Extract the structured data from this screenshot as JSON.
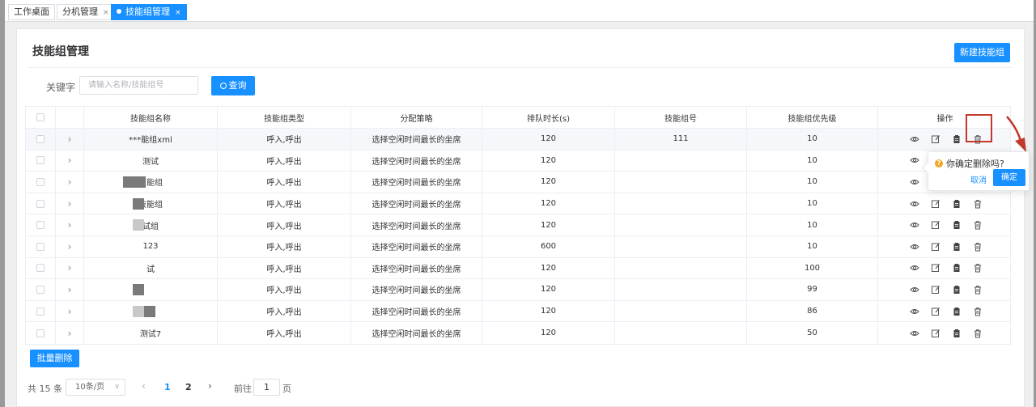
{
  "tabs": [
    {
      "label": "工作桌面",
      "closable": false,
      "active": false
    },
    {
      "label": "分机管理",
      "closable": true,
      "active": false
    },
    {
      "label": "技能组管理",
      "closable": true,
      "active": true
    }
  ],
  "tab_close_glyph": "×",
  "page": {
    "title": "技能组管理",
    "new_button": "新建技能组"
  },
  "search": {
    "label": "关键字",
    "placeholder": "请输入名称/技能组号",
    "value": "",
    "button": "查询"
  },
  "table": {
    "headers": [
      "技能组名称",
      "技能组类型",
      "分配策略",
      "排队时长(s)",
      "技能组号",
      "技能组优先级",
      "操作"
    ],
    "expand_glyph": "›",
    "rows": [
      {
        "name": "***能组xml",
        "type": "呼入,呼出",
        "strategy": "选择空闲时间最长的坐席",
        "queue": "120",
        "code": "111",
        "priority": "10"
      },
      {
        "name": "测试",
        "type": "呼入,呼出",
        "strategy": "选择空闲时间最长的坐席",
        "queue": "120",
        "code": "",
        "priority": "10"
      },
      {
        "name": "技能组",
        "type": "呼入,呼出",
        "strategy": "选择空闲时间最长的坐席",
        "queue": "120",
        "code": "",
        "priority": "10"
      },
      {
        "name": "技能组",
        "type": "呼入,呼出",
        "strategy": "选择空闲时间最长的坐席",
        "queue": "120",
        "code": "",
        "priority": "10"
      },
      {
        "name": "试组",
        "type": "呼入,呼出",
        "strategy": "选择空闲时间最长的坐席",
        "queue": "120",
        "code": "",
        "priority": "10"
      },
      {
        "name": "123",
        "type": "呼入,呼出",
        "strategy": "选择空闲时间最长的坐席",
        "queue": "600",
        "code": "",
        "priority": "10"
      },
      {
        "name": "试",
        "type": "呼入,呼出",
        "strategy": "选择空闲时间最长的坐席",
        "queue": "120",
        "code": "",
        "priority": "100"
      },
      {
        "name": "",
        "type": "呼入,呼出",
        "strategy": "选择空闲时间最长的坐席",
        "queue": "120",
        "code": "",
        "priority": "99"
      },
      {
        "name": "",
        "type": "呼入,呼出",
        "strategy": "选择空闲时间最长的坐席",
        "queue": "120",
        "code": "",
        "priority": "86"
      },
      {
        "name": "测试7",
        "type": "呼入,呼出",
        "strategy": "选择空闲时间最长的坐席",
        "queue": "120",
        "code": "",
        "priority": "50"
      }
    ],
    "row_actions": [
      "eye-icon",
      "edit-icon",
      "clipboard-icon",
      "trash-icon"
    ]
  },
  "batch_delete": "批量删除",
  "pagination": {
    "total": "共 15 条",
    "page_size": "10条/页",
    "pages": [
      "1",
      "2"
    ],
    "current": "1",
    "prev_glyph": "‹",
    "next_glyph": "›",
    "goto_label": "前往",
    "goto_value": "1",
    "goto_suffix": "页"
  },
  "popconfirm": {
    "icon": "?",
    "message": "你确定删除吗?",
    "cancel": "取消",
    "confirm": "确定"
  },
  "colors": {
    "primary": "#1890ff",
    "highlight": "#c0392b",
    "warning": "#f5a623"
  }
}
